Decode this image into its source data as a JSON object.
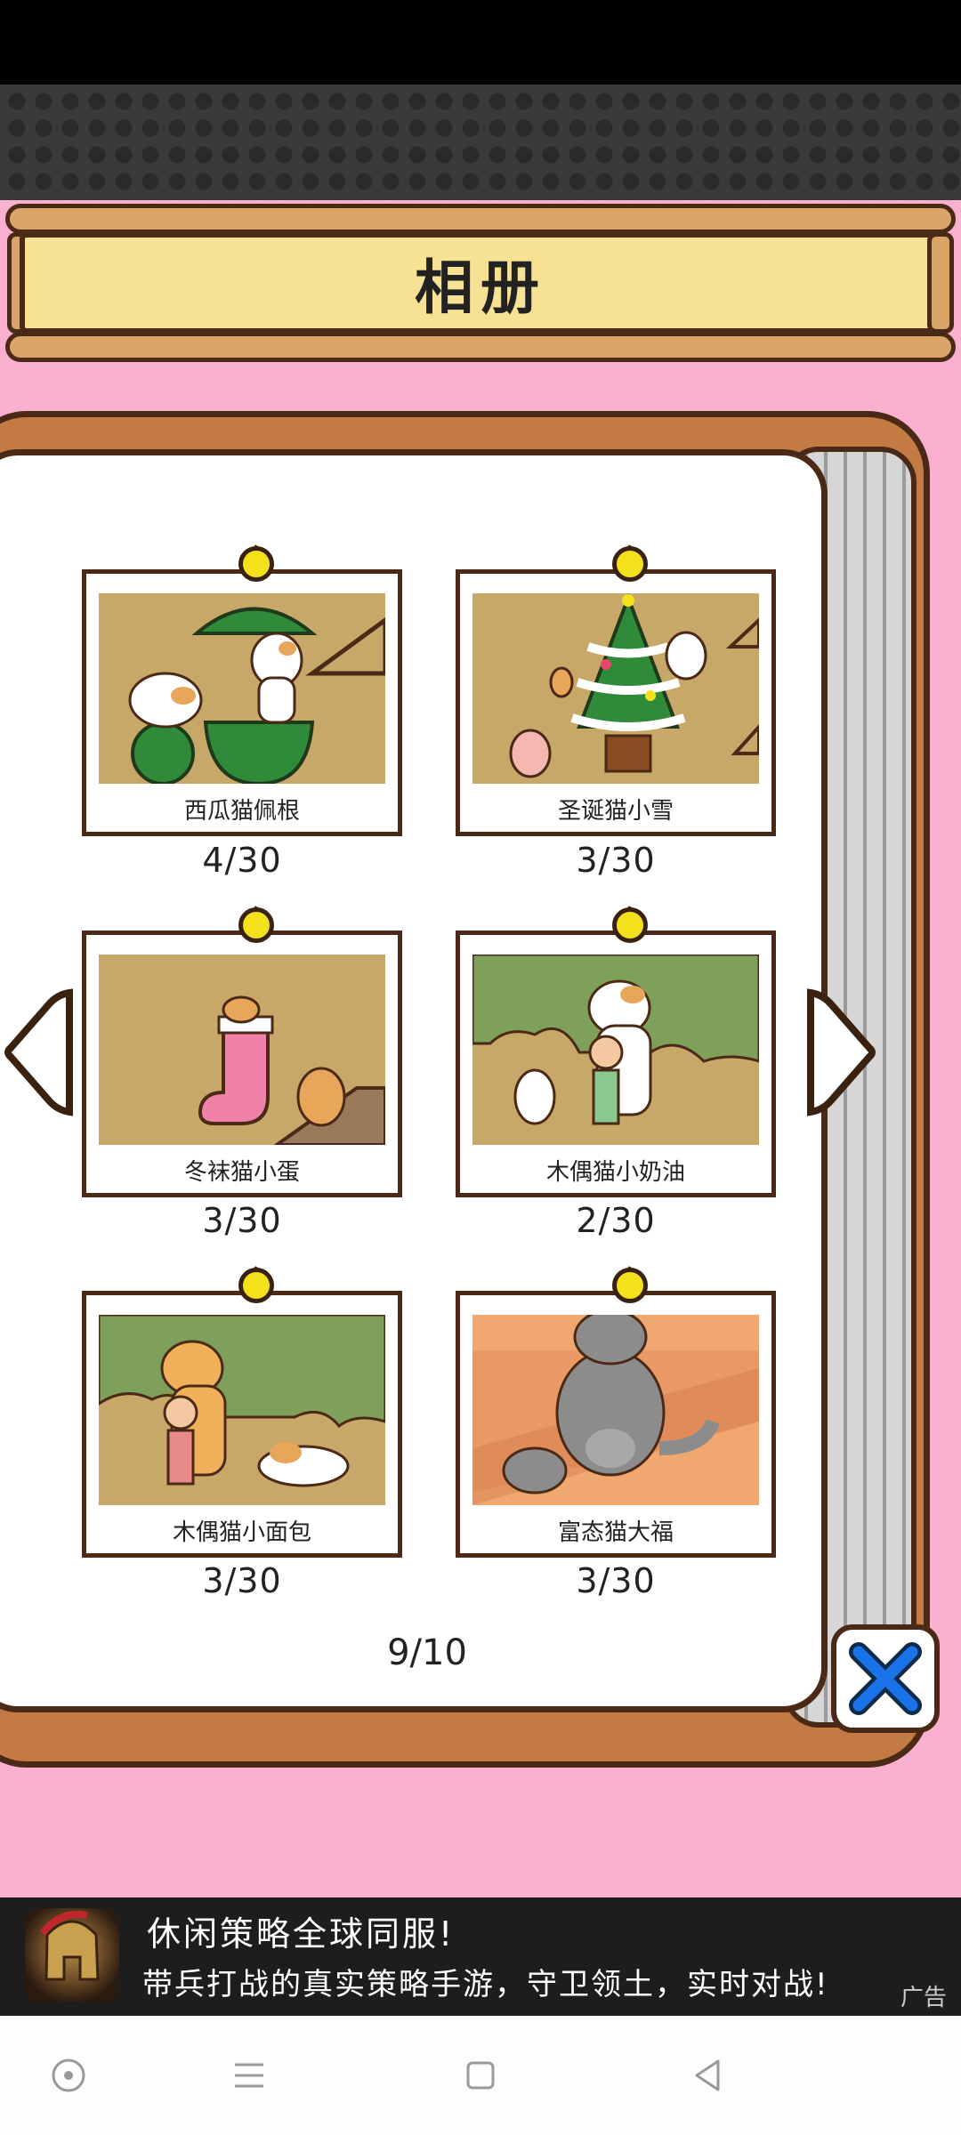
{
  "page": {
    "title": "相册",
    "page_indicator": "9/10"
  },
  "album": {
    "cards": [
      {
        "name": "西瓜猫佩根",
        "count": "4/30"
      },
      {
        "name": "圣诞猫小雪",
        "count": "3/30"
      },
      {
        "name": "冬袜猫小蛋",
        "count": "3/30"
      },
      {
        "name": "木偶猫小奶油",
        "count": "2/30"
      },
      {
        "name": "木偶猫小面包",
        "count": "3/30"
      },
      {
        "name": "富态猫大福",
        "count": "3/30"
      }
    ]
  },
  "ad": {
    "title": "休闲策略全球同服!",
    "description": "带兵打战的真实策略手游，守卫领土，实时对战!",
    "label": "广告"
  },
  "colors": {
    "background": "#fab0cf",
    "wood": "#c47a43",
    "outline": "#4a2a17",
    "banner": "#f7e192",
    "close_x": "#1a73e8"
  },
  "icons": [
    "prev-arrow-icon",
    "next-arrow-icon",
    "close-icon",
    "nav-home-icon",
    "nav-menu-icon",
    "nav-square-icon",
    "nav-back-icon"
  ]
}
